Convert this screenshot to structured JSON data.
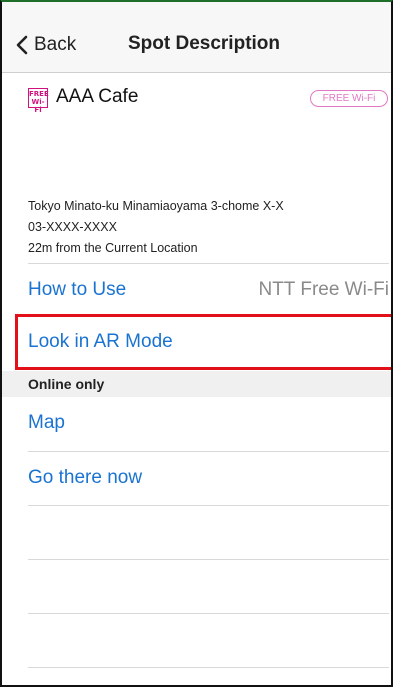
{
  "nav": {
    "back_label": "Back",
    "title": "Spot Description"
  },
  "spot": {
    "icon_text": "FREE Wi-Fi",
    "name": "AAA Cafe",
    "badge": "FREE Wi-Fi",
    "address": "Tokyo Minato-ku Minamiaoyama 3-chome X-X",
    "phone": "03-XXXX-XXXX",
    "distance": "22m from the Current Location"
  },
  "rows": {
    "how_to_use": {
      "label": "How to Use",
      "value": "NTT Free Wi-Fi"
    },
    "ar_mode": {
      "label": "Look in AR Mode"
    }
  },
  "section": {
    "title": "Online only"
  },
  "online_rows": [
    {
      "label": "Map"
    },
    {
      "label": "Go there now"
    }
  ],
  "colors": {
    "link": "#1a73d1",
    "highlight": "#e3101a",
    "badge": "#e079c4"
  }
}
